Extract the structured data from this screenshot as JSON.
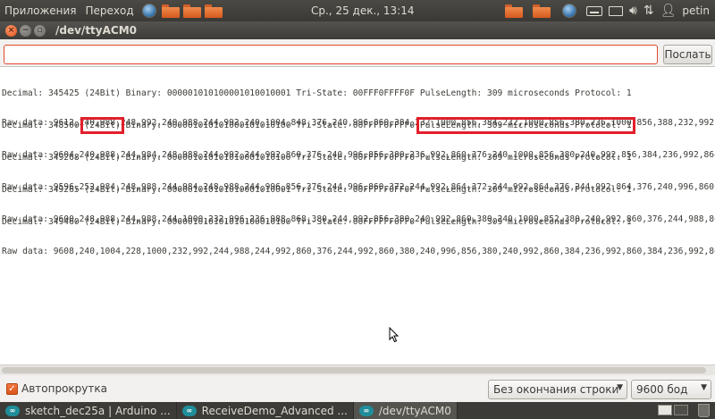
{
  "top_panel": {
    "menu": [
      "Приложения",
      "Переход"
    ],
    "clock": "Ср., 25 дек., 13:14",
    "user": "petin",
    "tray_icons": [
      "keyboard-icon",
      "mail-icon",
      "volume-icon",
      "network-icon",
      "user-icon"
    ]
  },
  "window": {
    "title": "/dev/ttyACM0",
    "send_input": {
      "value": "",
      "placeholder": ""
    },
    "send_button": "Послать",
    "output_blocks": [
      {
        "decimal_line": "Decimal: 345425 (24Bit) Binary: 000001010100001010010001 Tri-State: 00FFF0FFFF0F PulseLength: 309 microseconds Protocol: 1",
        "raw_line": "Raw data: 9612,240,988,248,992,240,988,244,992,240,1004,848,376,240,996,860,384,232,1000,856,384,232,1000,856,380,236,1000,856,388,232,992,860,388"
      },
      {
        "decimal_prefix": "Decimal: 348500 ",
        "decimal_bits": "(24Bit)",
        "decimal_middle": " Binary: 000001010101000101010100 Tri-State: 00FFFF0FFFF0 ",
        "decimal_pulse": "PulseLength: 309 microseconds Protocol: 1",
        "raw_line": "Raw data: 9604,240,988,244,984,248,988,244,992,244,992,860,376,240,996,856,380,236,992,860,376,240,1000,856,380,240,992,856,384,236,992,864,380,236"
      },
      {
        "decimal_line": "Decimal: 349268 (24Bit) Binary: 000001010101010001010100 Tri-State: 00FFFFF0FFF0 PulseLength: 309 microseconds Protocol: 1",
        "raw_line": "Raw data: 9596,252,984,248,988,244,984,248,988,244,996,856,376,244,996,860,372,244,992,864,372,244,992,864,376,244,992,864,376,240,996,860,372,244"
      },
      {
        "decimal_line": "Decimal: 349265 (24Bit) Binary: 000001010101010001010001 Tri-State: 00FFFFF0FF0F PulseLength: 309 microseconds Protocol: 1",
        "raw_line": "Raw data: 9600,248,988,244,988,244,1000,232,996,236,988,868,380,244,992,856,380,240,992,860,380,240,1000,852,380,240,992,860,376,244,988,864,380,244"
      },
      {
        "decimal_line": "Decimal: 349460 (24Bit) Binary: 000001010101010100010100 Tri-State: 00FFFFFF0FF0 PulseLength: 309 microseconds Protocol: 1",
        "raw_line": "Raw data: 9608,240,1004,228,1000,232,992,244,988,244,992,860,376,244,992,860,380,240,996,856,380,240,992,860,384,236,992,860,384,236,992,860,384,236"
      }
    ],
    "autoscroll": {
      "label": "Автопрокрутка",
      "checked": true
    },
    "line_ending": "Без окончания строки",
    "baud_rate": "9600 бод"
  },
  "taskbar": {
    "items": [
      "sketch_dec25a | Arduino ...",
      "ReceiveDemo_Advanced ...",
      "/dev/ttyACM0"
    ]
  }
}
